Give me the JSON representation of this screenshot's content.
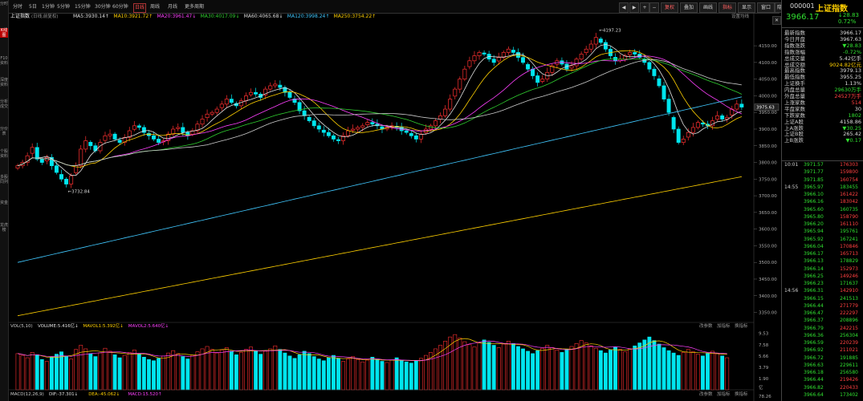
{
  "left_tabs": [
    "分时",
    "K线图",
    "F10资料",
    "深度资料",
    "分析成交",
    "分价表",
    "个股资料",
    "多股同列",
    "资金",
    "龙虎榜"
  ],
  "toolbar": {
    "periods": [
      "分时",
      "5日",
      "1分钟",
      "5分钟",
      "15分钟",
      "30分钟",
      "60分钟",
      "日线",
      "周线",
      "月线",
      "更多周期"
    ],
    "active_period": "日线",
    "right_buttons": [
      "◀",
      "▶",
      "+",
      "−",
      "复权",
      "叠加",
      "画线",
      "指标",
      "显示",
      "窗口"
    ],
    "hide_label": "隐藏",
    "close_icon": "✕"
  },
  "chart_header": {
    "name": "上证指数",
    "note": "(日线,前复权)",
    "ma": [
      {
        "label": "MA5:3930.14↑",
        "color": "#e0e0e0"
      },
      {
        "label": "MA10:3921.72↑",
        "color": "#ffd000"
      },
      {
        "label": "MA20:3961.47↓",
        "color": "#ff40ff"
      },
      {
        "label": "MA30:4017.09↓",
        "color": "#30d030"
      },
      {
        "label": "MA60:4065.68↓",
        "color": "#dddddd"
      },
      {
        "label": "MA120:3998.24↑",
        "color": "#40c8ff"
      },
      {
        "label": "MA250:3754.22↑",
        "color": "#ffd000"
      }
    ],
    "settings": "设置均线"
  },
  "annotations": {
    "high": "4197.23",
    "low": "3732.84",
    "last": "3975.63"
  },
  "y_axis": [
    "4150.00",
    "4100.00",
    "4050.00",
    "4000.00",
    "3950.00",
    "3900.00",
    "3850.00",
    "3800.00",
    "3750.00",
    "3700.00",
    "3650.00",
    "3600.00",
    "3550.00",
    "3500.00",
    "3450.00",
    "3400.00",
    "3350.00"
  ],
  "vol_header": {
    "label": "VOL(5,10)",
    "items": [
      {
        "label": "VOLUME:5.416亿↓",
        "color": "#e0e0e0"
      },
      {
        "label": "MAVOL1:5.392亿↓",
        "color": "#ffd000"
      },
      {
        "label": "MAVOL2:5.640亿↓",
        "color": "#ff40ff"
      }
    ],
    "buttons": [
      "改参数",
      "加指标",
      "换指标"
    ]
  },
  "vol_axis": [
    "9.53",
    "7.58",
    "5.66",
    "3.79",
    "1.90"
  ],
  "vol_unit": "亿",
  "macd_header": {
    "label": "MACD(12,26,9)",
    "items": [
      {
        "label": "DIF:-37.301↓",
        "color": "#e0e0e0"
      },
      {
        "label": "DEA:-45.062↓",
        "color": "#ffd000"
      },
      {
        "label": "MACD:15.520↑",
        "color": "#ff40ff"
      }
    ],
    "buttons": [
      "改参数",
      "加指标",
      "换指标"
    ],
    "axis_val": "78.26"
  },
  "quote": {
    "code": "000001",
    "name": "上证指数",
    "price": "3966.17",
    "change": "↓28.83",
    "change_pct": "0.72%",
    "stats": [
      {
        "label": "最新指数",
        "value": "3966.17",
        "c": "white"
      },
      {
        "label": "今日开盘",
        "value": "3967.63",
        "c": "white"
      },
      {
        "label": "指数涨跌",
        "value": "▼28.83",
        "c": "green"
      },
      {
        "label": "指数涨幅",
        "value": "-0.72%",
        "c": "green"
      },
      {
        "label": "总成交量",
        "value": "5.42亿手",
        "c": "white"
      },
      {
        "label": "总成交额",
        "value": "9024.82亿元",
        "c": "yellow"
      },
      {
        "label": "最高指数",
        "value": "3979.13",
        "c": "white"
      },
      {
        "label": "最低指数",
        "value": "3955.25",
        "c": "white"
      },
      {
        "label": "上证换手",
        "value": "1.13%",
        "c": "white"
      },
      {
        "label": "内盘总量",
        "value": "29630万手",
        "c": "green"
      },
      {
        "label": "外盘总量",
        "value": "24527万手",
        "c": "red"
      },
      {
        "label": "上涨家数",
        "value": "514",
        "c": "red"
      },
      {
        "label": "平盘家数",
        "value": "30",
        "c": "white"
      },
      {
        "label": "下跌家数",
        "value": "1802",
        "c": "green"
      },
      {
        "label": "上证A股",
        "value": "4158.86",
        "c": "white"
      },
      {
        "label": "上A涨跌",
        "value": "▼30.25",
        "c": "green"
      },
      {
        "label": "上证B股",
        "value": "265.42",
        "c": "white"
      },
      {
        "label": "上B涨跌",
        "value": "▼0.17",
        "c": "green"
      }
    ],
    "ticks": [
      {
        "t": "10:01",
        "p": "3971.57",
        "v": "176303",
        "pc": "green",
        "vc": "red"
      },
      {
        "t": "",
        "p": "3971.77",
        "v": "159800",
        "pc": "green",
        "vc": "red"
      },
      {
        "t": "",
        "p": "3971.85",
        "v": "160754",
        "pc": "green",
        "vc": "red"
      },
      {
        "t": "14:55",
        "p": "3965.97",
        "v": "183455",
        "pc": "green",
        "vc": "green"
      },
      {
        "t": "",
        "p": "3966.10",
        "v": "161422",
        "pc": "green",
        "vc": "red"
      },
      {
        "t": "",
        "p": "3966.16",
        "v": "183042",
        "pc": "green",
        "vc": "red"
      },
      {
        "t": "",
        "p": "3965.60",
        "v": "160735",
        "pc": "green",
        "vc": "green"
      },
      {
        "t": "",
        "p": "3965.80",
        "v": "158790",
        "pc": "green",
        "vc": "red"
      },
      {
        "t": "",
        "p": "3966.20",
        "v": "161110",
        "pc": "green",
        "vc": "red"
      },
      {
        "t": "",
        "p": "3965.94",
        "v": "195761",
        "pc": "green",
        "vc": "green"
      },
      {
        "t": "",
        "p": "3965.92",
        "v": "167241",
        "pc": "green",
        "vc": "green"
      },
      {
        "t": "",
        "p": "3966.04",
        "v": "170846",
        "pc": "green",
        "vc": "red"
      },
      {
        "t": "",
        "p": "3966.17",
        "v": "165713",
        "pc": "green",
        "vc": "red"
      },
      {
        "t": "",
        "p": "3966.13",
        "v": "178829",
        "pc": "green",
        "vc": "green"
      },
      {
        "t": "",
        "p": "3966.14",
        "v": "152973",
        "pc": "green",
        "vc": "red"
      },
      {
        "t": "",
        "p": "3966.25",
        "v": "149246",
        "pc": "green",
        "vc": "red"
      },
      {
        "t": "",
        "p": "3966.23",
        "v": "171637",
        "pc": "green",
        "vc": "green"
      },
      {
        "t": "14:56",
        "p": "3966.31",
        "v": "142910",
        "pc": "green",
        "vc": "red"
      },
      {
        "t": "",
        "p": "3966.15",
        "v": "241513",
        "pc": "green",
        "vc": "green"
      },
      {
        "t": "",
        "p": "3966.44",
        "v": "271779",
        "pc": "green",
        "vc": "red"
      },
      {
        "t": "",
        "p": "3966.47",
        "v": "222297",
        "pc": "green",
        "vc": "red"
      },
      {
        "t": "",
        "p": "3966.37",
        "v": "208896",
        "pc": "green",
        "vc": "green"
      },
      {
        "t": "",
        "p": "3966.79",
        "v": "242215",
        "pc": "green",
        "vc": "red"
      },
      {
        "t": "",
        "p": "3966.36",
        "v": "256304",
        "pc": "green",
        "vc": "green"
      },
      {
        "t": "",
        "p": "3966.59",
        "v": "220239",
        "pc": "green",
        "vc": "red"
      },
      {
        "t": "",
        "p": "3966.92",
        "v": "211021",
        "pc": "green",
        "vc": "red"
      },
      {
        "t": "",
        "p": "3966.72",
        "v": "191885",
        "pc": "green",
        "vc": "green"
      },
      {
        "t": "",
        "p": "3966.63",
        "v": "229611",
        "pc": "green",
        "vc": "green"
      },
      {
        "t": "",
        "p": "3966.18",
        "v": "256580",
        "pc": "green",
        "vc": "green"
      },
      {
        "t": "",
        "p": "3966.44",
        "v": "219426",
        "pc": "green",
        "vc": "red"
      },
      {
        "t": "",
        "p": "3966.82",
        "v": "220433",
        "pc": "green",
        "vc": "red"
      },
      {
        "t": "",
        "p": "3966.64",
        "v": "173402",
        "pc": "green",
        "vc": "green"
      }
    ]
  },
  "colors": {
    "up": "#ff3030",
    "down": "#00e5ee",
    "ma5": "#e0e0e0",
    "ma10": "#ffd000",
    "ma20": "#ff40ff",
    "ma30": "#30d030",
    "ma60": "#cccccc",
    "ma120": "#40c8ff",
    "ma250": "#ffd000"
  },
  "chart_data": {
    "type": "candlestick",
    "price_range": [
      3320,
      4220
    ],
    "closes": [
      3790,
      3800,
      3820,
      3845,
      3810,
      3800,
      3815,
      3790,
      3770,
      3750,
      3735,
      3760,
      3790,
      3840,
      3865,
      3850,
      3835,
      3860,
      3880,
      3885,
      3870,
      3860,
      3875,
      3895,
      3910,
      3905,
      3890,
      3880,
      3870,
      3860,
      3865,
      3885,
      3900,
      3905,
      3890,
      3880,
      3895,
      3915,
      3930,
      3945,
      3950,
      3960,
      3975,
      3990,
      3980,
      3970,
      3985,
      4000,
      4010,
      4005,
      3995,
      4020,
      4030,
      4035,
      4025,
      4010,
      3995,
      3980,
      3955,
      3940,
      3925,
      3910,
      3900,
      3890,
      3880,
      3870,
      3865,
      3880,
      3895,
      3900,
      3905,
      3910,
      3920,
      3915,
      3910,
      3900,
      3905,
      3910,
      3905,
      3895,
      3890,
      3880,
      3870,
      3885,
      3900,
      3910,
      3925,
      3940,
      3960,
      3990,
      4020,
      4050,
      4080,
      4105,
      4120,
      4130,
      4125,
      4110,
      4100,
      4115,
      4130,
      4140,
      4130,
      4115,
      4100,
      4080,
      4060,
      4040,
      4050,
      4070,
      4090,
      4105,
      4095,
      4080,
      4090,
      4110,
      4125,
      4140,
      4155,
      4175,
      4160,
      4140,
      4120,
      4105,
      4110,
      4120,
      4130,
      4125,
      4115,
      4100,
      4080,
      4060,
      4030,
      3990,
      3950,
      3900,
      3860,
      3870,
      3890,
      3905,
      3920,
      3915,
      3910,
      3925,
      3940,
      3930,
      3935,
      3960,
      3975,
      3966
    ],
    "volume": [
      6.1,
      5.8,
      5.4,
      6.3,
      5.9,
      5.1,
      4.8,
      5.5,
      6.0,
      6.4,
      5.7,
      5.2,
      6.8,
      7.5,
      6.9,
      6.1,
      5.6,
      6.2,
      7.0,
      6.5,
      5.9,
      5.4,
      5.8,
      6.3,
      6.7,
      6.0,
      5.5,
      5.1,
      4.9,
      5.3,
      5.7,
      6.2,
      6.6,
      6.1,
      5.6,
      5.2,
      5.8,
      6.4,
      6.9,
      7.3,
      6.8,
      6.2,
      6.7,
      7.1,
      6.5,
      5.9,
      6.3,
      6.8,
      7.2,
      6.6,
      6.0,
      6.5,
      6.9,
      7.4,
      6.8,
      6.2,
      5.7,
      5.3,
      5.9,
      6.5,
      6.1,
      5.6,
      5.2,
      4.9,
      5.4,
      5.8,
      5.3,
      4.8,
      5.2,
      5.6,
      5.1,
      4.7,
      5.0,
      5.5,
      5.1,
      4.8,
      4.6,
      5.0,
      5.4,
      5.0,
      4.7,
      4.5,
      4.9,
      5.3,
      5.8,
      6.3,
      6.9,
      7.5,
      8.2,
      8.9,
      9.3,
      8.7,
      8.1,
      7.6,
      7.2,
      7.9,
      8.4,
      8.0,
      7.5,
      7.1,
      7.7,
      8.2,
      7.8,
      7.3,
      6.9,
      6.5,
      6.1,
      6.6,
      7.0,
      7.5,
      7.1,
      6.7,
      6.3,
      6.8,
      7.3,
      7.8,
      8.3,
      7.9,
      7.4,
      7.0,
      6.6,
      6.2,
      6.7,
      7.2,
      6.8,
      6.4,
      6.9,
      7.4,
      7.9,
      8.4,
      8.9,
      8.3,
      7.7,
      7.1,
      6.6,
      6.2,
      5.8,
      6.3,
      6.8,
      6.4,
      6.0,
      5.7,
      6.1,
      6.5,
      6.1,
      5.7,
      5.4
    ]
  }
}
